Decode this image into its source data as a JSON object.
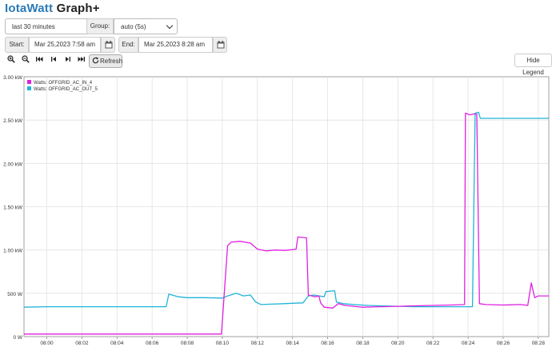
{
  "header": {
    "brand": "IotaWatt",
    "subtitle": " Graph+"
  },
  "controls": {
    "range_value": "last 30 minutes",
    "group_label": "Group:",
    "group_value": "auto (5s)",
    "start_label": "Start:",
    "start_value": "Mar 25,2023 7:58 am",
    "end_label": "End:",
    "end_value": "Mar 25,2023 8:28 am",
    "refresh_label": "Refresh",
    "hide_legend_label": "Hide Legend",
    "toolbar_icons": [
      "zoom-in-icon",
      "zoom-out-icon",
      "skip-back-icon",
      "step-back-icon",
      "step-forward-icon",
      "skip-forward-icon"
    ]
  },
  "colors": {
    "accent": "#2a7ab8",
    "series_in": "#e020e0",
    "series_out": "#20b4d8"
  },
  "chart_data": {
    "type": "line",
    "y_ticks": [
      "0 W",
      "500 W",
      "1.00 kW",
      "1.50 kW",
      "2.00 kW",
      "2.50 kW",
      "3.00 kW"
    ],
    "x_ticks": [
      "08:00",
      "08:02",
      "08:04",
      "08:06",
      "08:08",
      "08:10",
      "08:12",
      "08:14",
      "08:16",
      "08:18",
      "08:20",
      "08:22",
      "08:24",
      "08:26",
      "08:28"
    ],
    "xlim": [
      -1.3,
      28.6
    ],
    "ylim": [
      0,
      3000
    ],
    "grid": true,
    "legend_position": "top-left",
    "series": [
      {
        "name": "Watts: OFFGRID_AC_IN_4",
        "points": [
          [
            -1.3,
            30
          ],
          [
            9.95,
            30
          ],
          [
            10.3,
            1050
          ],
          [
            10.5,
            1090
          ],
          [
            11.0,
            1100
          ],
          [
            11.6,
            1080
          ],
          [
            12.0,
            1010
          ],
          [
            12.5,
            990
          ],
          [
            13.0,
            1000
          ],
          [
            13.6,
            995
          ],
          [
            14.0,
            1005
          ],
          [
            14.2,
            1010
          ],
          [
            14.3,
            1150
          ],
          [
            14.8,
            1140
          ],
          [
            14.9,
            480
          ],
          [
            15.3,
            460
          ],
          [
            15.5,
            470
          ],
          [
            15.6,
            390
          ],
          [
            15.8,
            340
          ],
          [
            16.3,
            330
          ],
          [
            16.6,
            380
          ],
          [
            17.0,
            360
          ],
          [
            17.5,
            350
          ],
          [
            18.0,
            340
          ],
          [
            19.0,
            345
          ],
          [
            20.0,
            350
          ],
          [
            21.0,
            355
          ],
          [
            22.0,
            360
          ],
          [
            23.0,
            365
          ],
          [
            23.8,
            370
          ],
          [
            23.85,
            2580
          ],
          [
            24.1,
            2560
          ],
          [
            24.3,
            2570
          ],
          [
            24.5,
            2570
          ],
          [
            24.65,
            380
          ],
          [
            25.0,
            370
          ],
          [
            26.0,
            365
          ],
          [
            27.0,
            370
          ],
          [
            27.4,
            360
          ],
          [
            27.6,
            620
          ],
          [
            27.8,
            450
          ],
          [
            28.0,
            470
          ],
          [
            28.6,
            470
          ]
        ]
      },
      {
        "name": "Watts: OFFGRID_AC_OUT_5",
        "points": [
          [
            -1.3,
            340
          ],
          [
            0,
            345
          ],
          [
            2,
            345
          ],
          [
            4,
            345
          ],
          [
            6.8,
            345
          ],
          [
            6.95,
            490
          ],
          [
            7.5,
            460
          ],
          [
            8.0,
            450
          ],
          [
            9.0,
            450
          ],
          [
            10.0,
            445
          ],
          [
            10.3,
            470
          ],
          [
            10.8,
            500
          ],
          [
            11.2,
            470
          ],
          [
            11.6,
            480
          ],
          [
            11.9,
            400
          ],
          [
            12.2,
            370
          ],
          [
            12.8,
            375
          ],
          [
            13.5,
            380
          ],
          [
            14.0,
            385
          ],
          [
            14.6,
            390
          ],
          [
            14.9,
            470
          ],
          [
            15.2,
            480
          ],
          [
            15.8,
            460
          ],
          [
            15.9,
            520
          ],
          [
            16.4,
            530
          ],
          [
            16.5,
            400
          ],
          [
            16.9,
            380
          ],
          [
            17.5,
            370
          ],
          [
            18.3,
            360
          ],
          [
            19.0,
            355
          ],
          [
            20.0,
            350
          ],
          [
            21.0,
            345
          ],
          [
            22.0,
            345
          ],
          [
            23.0,
            345
          ],
          [
            23.9,
            345
          ],
          [
            24.25,
            345
          ],
          [
            24.4,
            2580
          ],
          [
            24.6,
            2590
          ],
          [
            24.7,
            2520
          ],
          [
            28.6,
            2520
          ]
        ]
      }
    ]
  }
}
